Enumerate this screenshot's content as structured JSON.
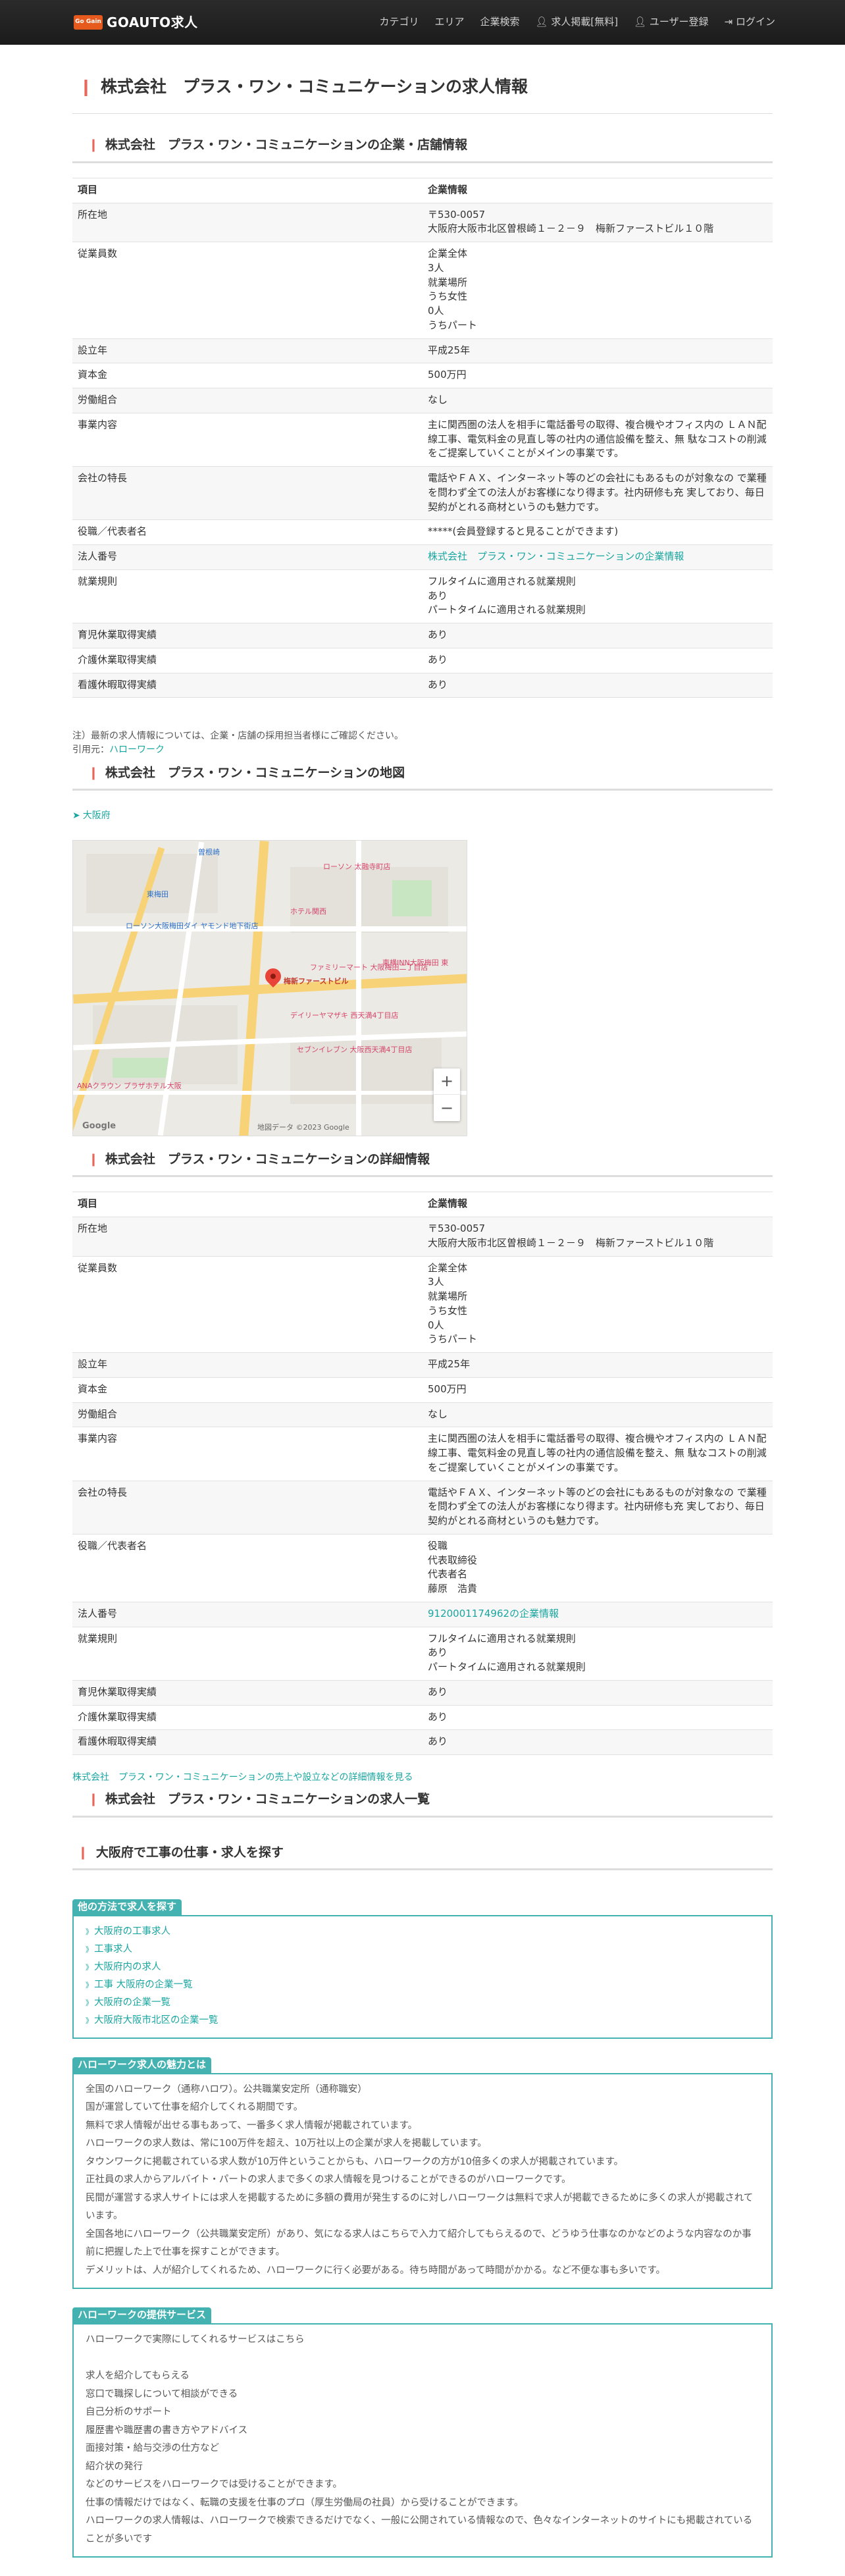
{
  "header": {
    "logo_badge": "Go Gain",
    "logo_text": "GOAUTO求人",
    "nav": [
      "カテゴリ",
      "エリア",
      "企業検索",
      "求人掲載[無料]",
      "ユーザー登録",
      "ログイン"
    ]
  },
  "page_title": "株式会社　プラス・ワン・コミュニケーションの求人情報",
  "company_section": {
    "title": "株式会社　プラス・ワン・コミュニケーションの企業・店舗情報",
    "header": [
      "項目",
      "企業情報"
    ],
    "rows": [
      [
        "所在地",
        "〒530-0057\n大阪府大阪市北区曽根崎１－２－９　梅新ファーストビル１０階"
      ],
      [
        "従業員数",
        "企業全体\n3人\n就業場所\nうち女性\n0人\nうちパート"
      ],
      [
        "設立年",
        "平成25年"
      ],
      [
        "資本金",
        "500万円"
      ],
      [
        "労働組合",
        "なし"
      ],
      [
        "事業内容",
        "主に関西圏の法人を相手に電話番号の取得、複合機やオフィス内の ＬＡＮ配線工事、電気料金の見直し等の社内の通信設備を整え、無 駄なコストの削減をご提案していくことがメインの事業です。"
      ],
      [
        "会社の特長",
        "電話やＦＡＸ、インターネット等のどの会社にもあるものが対象なの で業種を問わず全ての法人がお客様になり得ます。社内研修も充 実しており、毎日契約がとれる商材というのも魅力です。"
      ],
      [
        "役職／代表者名",
        "*****(会員登録すると見ることができます)"
      ],
      [
        "法人番号",
        "株式会社　プラス・ワン・コミュニケーションの企業情報"
      ],
      [
        "就業規則",
        "フルタイムに適用される就業規則\nあり\nパートタイムに適用される就業規則"
      ],
      [
        "育児休業取得実績",
        "あり"
      ],
      [
        "介護休業取得実績",
        "あり"
      ],
      [
        "看護休暇取得実績",
        "あり"
      ]
    ]
  },
  "note": "注）最新の求人情報については、企業・店舗の採用担当者様にご確認ください。",
  "cite_label": "引用元：",
  "cite_link": "ハローワーク",
  "map_section": {
    "title": "株式会社　プラス・ワン・コミュニケーションの地図",
    "area_link": "大阪府",
    "pin_label": "梅新ファーストビル",
    "labels": [
      "ローソン 太融寺町店",
      "東梅田",
      "ローソン大阪梅田ダイ ヤモンド地下街店",
      "ファミリーマート 大阪梅田二丁目店",
      "ホテル関西",
      "デイリーヤマザキ 西天満4丁目店",
      "セブンイレブン 大阪西天満4丁目店",
      "ANAクラウン プラザホテル大阪",
      "東横INN大阪梅田 東",
      "曽根崎"
    ],
    "google": "Google",
    "copyright": "地図データ ©2023 Google"
  },
  "detail_section": {
    "title": "株式会社　プラス・ワン・コミュニケーションの詳細情報",
    "header": [
      "項目",
      "企業情報"
    ],
    "rows": [
      [
        "所在地",
        "〒530-0057\n大阪府大阪市北区曽根崎１－２－９　梅新ファーストビル１０階"
      ],
      [
        "従業員数",
        "企業全体\n3人\n就業場所\nうち女性\n0人\nうちパート"
      ],
      [
        "設立年",
        "平成25年"
      ],
      [
        "資本金",
        "500万円"
      ],
      [
        "労働組合",
        "なし"
      ],
      [
        "事業内容",
        "主に関西圏の法人を相手に電話番号の取得、複合機やオフィス内の ＬＡＮ配線工事、電気料金の見直し等の社内の通信設備を整え、無 駄なコストの削減をご提案していくことがメインの事業です。"
      ],
      [
        "会社の特長",
        "電話やＦＡＸ、インターネット等のどの会社にもあるものが対象なの で業種を問わず全ての法人がお客様になり得ます。社内研修も充 実しており、毎日契約がとれる商材というのも魅力です。"
      ],
      [
        "役職／代表者名",
        "役職\n代表取締役\n代表者名\n藤原　浩貴"
      ],
      [
        "法人番号",
        "9120001174962の企業情報"
      ],
      [
        "就業規則",
        "フルタイムに適用される就業規則\nあり\nパートタイムに適用される就業規則"
      ],
      [
        "育児休業取得実績",
        "あり"
      ],
      [
        "介護休業取得実績",
        "あり"
      ],
      [
        "看護休暇取得実績",
        "あり"
      ]
    ]
  },
  "corp_link": "株式会社　プラス・ワン・コミュニケーションの売上や設立などの詳細情報を見る",
  "jobs_title": "株式会社　プラス・ワン・コミュニケーションの求人一覧",
  "search_title": "大阪府で工事の仕事・求人を探す",
  "other_box": {
    "label": "他の方法で求人を探す",
    "items": [
      "大阪府の工事求人",
      "工事求人",
      "大阪府内の求人",
      "工事 大阪府の企業一覧",
      "大阪府の企業一覧",
      "大阪府大阪市北区の企業一覧"
    ]
  },
  "hw_box": {
    "label": "ハローワーク求人の魅力とは",
    "lines": [
      "全国のハローワーク（通称ハロワ）。公共職業安定所（通称職安）",
      "国が運営していて仕事を紹介してくれる期間です。",
      "無料で求人情報が出せる事もあって、一番多く求人情報が掲載されています。",
      "ハローワークの求人数は、常に100万件を超え、10万社以上の企業が求人を掲載しています。",
      "タウンワークに掲載されている求人数が10万件ということからも、ハローワークの方が10倍多くの求人が掲載されています。",
      "正社員の求人からアルバイト・パートの求人まで多くの求人情報を見つけることができるのがハローワークです。",
      "民間が運営する求人サイトには求人を掲載するために多額の費用が発生するのに対しハローワークは無料で求人が掲載できるために多くの求人が掲載されています。",
      "全国各地にハローワーク（公共職業安定所）があり、気になる求人はこちらで入力て紹介してもらえるので、どうゆう仕事なのかなどのような内容なのか事前に把握した上で仕事を探すことができます。",
      "デメリットは、人が紹介してくれるため、ハローワークに行く必要がある。待ち時間があって時間がかかる。など不便な事も多いです。"
    ]
  },
  "service_box": {
    "label": "ハローワークの提供サービス",
    "lines": [
      "ハローワークで実際にしてくれるサービスはこちら",
      "",
      "求人を紹介してもらえる",
      "窓口で職探しについて相談ができる",
      "自己分析のサポート",
      "履歴書や職歴書の書き方やアドバイス",
      "面接対策・給与交渉の仕方など",
      "紹介状の発行",
      "などのサービスをハローワークでは受けることができます。",
      "仕事の情報だけではなく、転職の支援を仕事のプロ（厚生労働局の社員）から受けることができます。",
      "ハローワークの求人情報は、ハローワークで検索できるだけでなく、一般に公開されている情報なので、色々なインターネットのサイトにも掲載されていることが多いです"
    ]
  }
}
